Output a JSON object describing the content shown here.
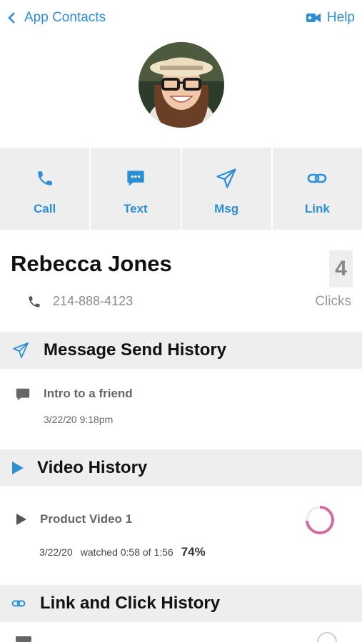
{
  "header": {
    "back_label": "App Contacts",
    "help_label": "Help"
  },
  "actions": [
    {
      "label": "Call",
      "icon": "phone-icon"
    },
    {
      "label": "Text",
      "icon": "chat-icon"
    },
    {
      "label": "Msg",
      "icon": "send-icon"
    },
    {
      "label": "Link",
      "icon": "link-icon"
    }
  ],
  "contact": {
    "name": "Rebecca Jones",
    "phone": "214-888-4123",
    "clicks_count": "4",
    "clicks_label": "Clicks"
  },
  "message_history": {
    "title": "Message Send History",
    "items": [
      {
        "title": "Intro to a friend",
        "date": "3/22/20 9:18pm"
      }
    ]
  },
  "video_history": {
    "title": "Video History",
    "items": [
      {
        "title": "Product Video 1",
        "date": "3/22/20",
        "watched": "watched 0:58 of 1:56",
        "percent_label": "74%",
        "percent": 0.74
      }
    ]
  },
  "link_history": {
    "title": "Link and Click History"
  },
  "colors": {
    "accent": "#2b8fd6",
    "section_bg": "#eeeeee",
    "progress": "#d46a9f"
  }
}
